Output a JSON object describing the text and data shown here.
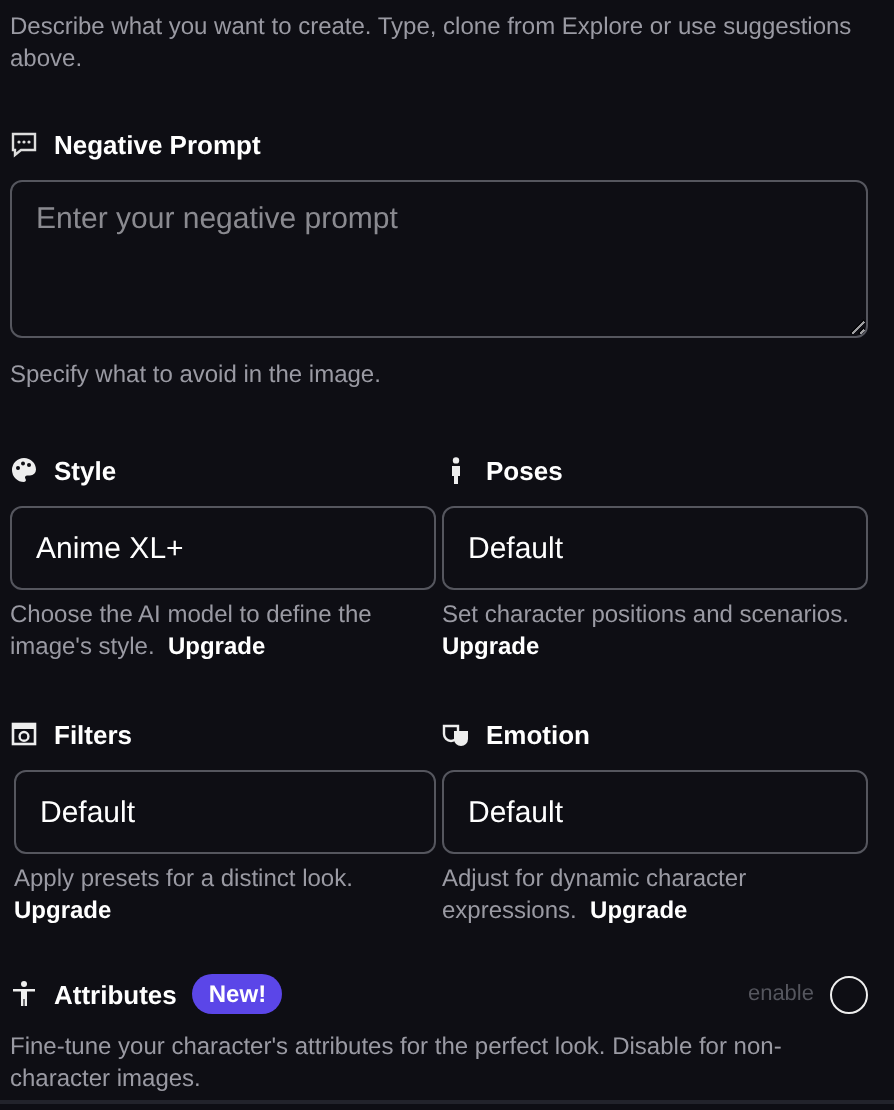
{
  "prompt_hint": "Describe what you want to create. Type, clone from Explore or use suggestions above.",
  "negative_prompt": {
    "title": "Negative Prompt",
    "placeholder": "Enter your negative prompt",
    "hint": "Specify what to avoid in the image."
  },
  "options": [
    {
      "kind": "style",
      "title": "Style",
      "value": "Anime XL+",
      "hint": "Choose the AI model to define the image's style.",
      "link": "Upgrade"
    },
    {
      "kind": "poses",
      "title": "Poses",
      "value": "Default",
      "hint": "Set character positions and scenarios.",
      "link": "Upgrade"
    },
    {
      "kind": "filters",
      "title": "Filters",
      "value": "Default",
      "hint": "Apply presets for a distinct look.",
      "link": "Upgrade"
    },
    {
      "kind": "emotion",
      "title": "Emotion",
      "value": "Default",
      "hint": "Adjust for dynamic character expressions.",
      "link": "Upgrade"
    }
  ],
  "attributes": {
    "title": "Attributes",
    "badge": "New!",
    "toggle_label": "enable",
    "checked": false,
    "hint": "Fine-tune your character's attributes for the perfect look. Disable for non-character images."
  }
}
